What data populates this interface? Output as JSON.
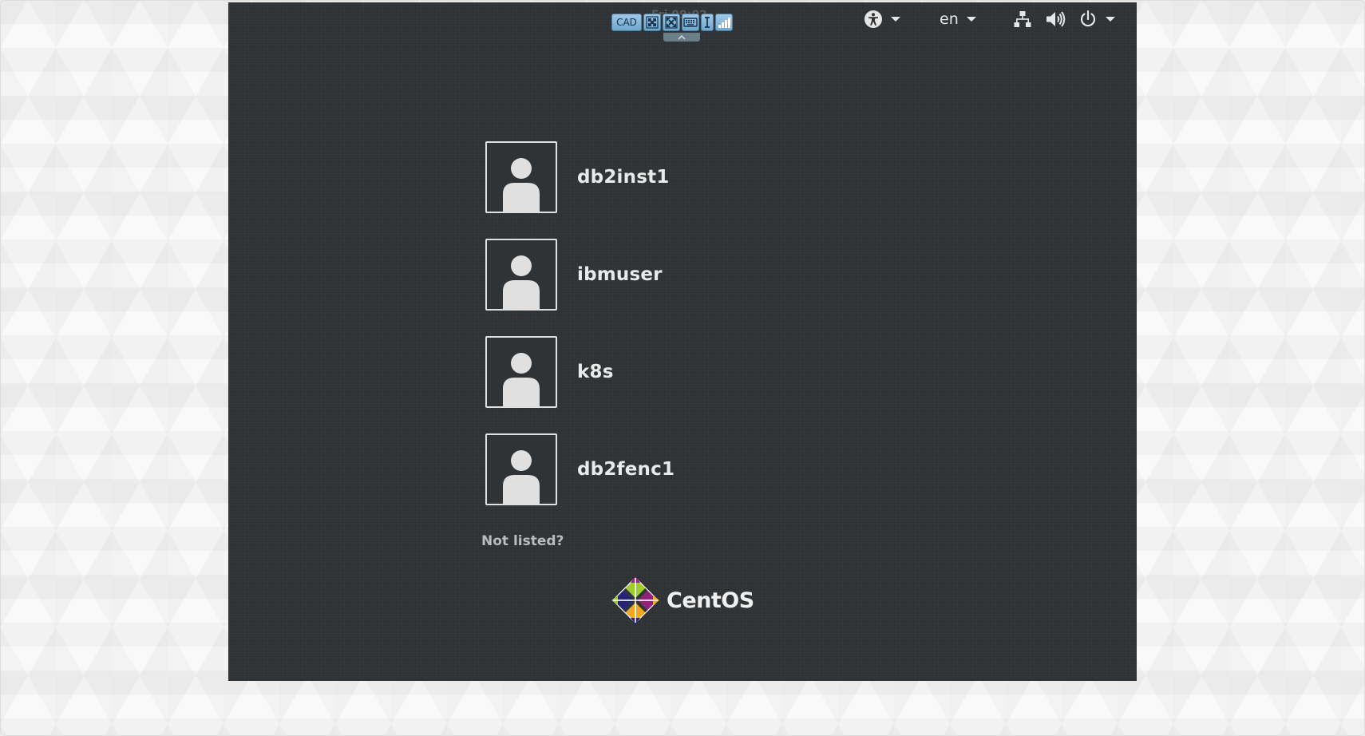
{
  "vnc_toolbar": {
    "cad_label": "CAD",
    "clock_ghost": "Fri 09:02",
    "buttons": [
      {
        "name": "cad-button",
        "icon": "ctrl-alt-del-icon"
      },
      {
        "name": "fit-screen-button",
        "icon": "fit-screen-icon"
      },
      {
        "name": "fullscreen-button",
        "icon": "fullscreen-icon"
      },
      {
        "name": "keyboard-button",
        "icon": "keyboard-icon"
      },
      {
        "name": "text-cursor-button",
        "icon": "text-cursor-icon"
      },
      {
        "name": "stats-button",
        "icon": "signal-bars-icon"
      }
    ],
    "colors": {
      "button_fill": "#7fb3d9",
      "button_border": "#4a7fa3",
      "handle": "#6b7f88"
    }
  },
  "topbar": {
    "accessibility_icon": "accessibility-icon",
    "language": "en",
    "network_icon": "network-wired-icon",
    "volume_icon": "volume-icon",
    "power_icon": "power-icon"
  },
  "users": [
    {
      "name": "db2inst1",
      "icon": "user-avatar-icon"
    },
    {
      "name": "ibmuser",
      "icon": "user-avatar-icon"
    },
    {
      "name": "k8s",
      "icon": "user-avatar-icon"
    },
    {
      "name": "db2fenc1",
      "icon": "user-avatar-icon"
    }
  ],
  "not_listed_label": "Not listed?",
  "branding": {
    "wordmark": "CentOS",
    "logo_colors": [
      "#9ccd2a",
      "#932279",
      "#efa724",
      "#262577"
    ]
  },
  "theme": {
    "screen_bg": "#2f3335",
    "page_bg": "#f2f2f2",
    "text": "#eaeaea",
    "muted_text": "#b9bdbf"
  }
}
